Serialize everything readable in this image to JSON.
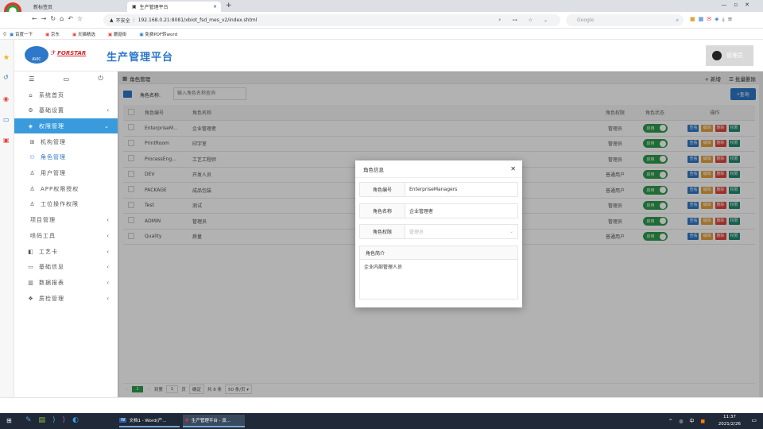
{
  "browser": {
    "tabs": [
      {
        "label": "新标签页"
      },
      {
        "label": "生产管理平台"
      }
    ],
    "security_label": "不安全",
    "url": "192.168.0.21:8081/xbiot_fsd_mes_v2/index.shtml",
    "search_engine": "Google",
    "bookmarks": [
      "百度一下",
      "京东",
      "天猫精选",
      "蘑菇街",
      "免费PDF转word"
    ]
  },
  "app": {
    "brand": "FORSTAR",
    "logo_sub": "AVIC",
    "title": "生产管理平台",
    "user_name": "管理员"
  },
  "sidebar": {
    "items": [
      {
        "label": "系统首页",
        "icon": "home-icon",
        "type": "top"
      },
      {
        "label": "基础设置",
        "icon": "gear-icon",
        "type": "top",
        "chev": "‹"
      },
      {
        "label": "权限管理",
        "icon": "shield-icon",
        "type": "active",
        "chev": "⌄"
      },
      {
        "label": "机构管理",
        "icon": "org-icon",
        "type": "sub"
      },
      {
        "label": "角色管理",
        "icon": "users-icon",
        "type": "subact"
      },
      {
        "label": "用户管理",
        "icon": "user-icon",
        "type": "sub"
      },
      {
        "label": "APP权限授权",
        "icon": "user-icon",
        "type": "sub"
      },
      {
        "label": "工位操作权限",
        "icon": "user-icon",
        "type": "sub"
      },
      {
        "label": "项目管理",
        "icon": "",
        "type": "top",
        "chev": "‹"
      },
      {
        "label": "喷码工具",
        "icon": "",
        "type": "top",
        "chev": "‹"
      },
      {
        "label": "工艺卡",
        "icon": "card-icon",
        "type": "top",
        "chev": "‹"
      },
      {
        "label": "基础信息",
        "icon": "monitor-icon",
        "type": "top",
        "chev": "‹"
      },
      {
        "label": "数据报表",
        "icon": "report-icon",
        "type": "top",
        "chev": "‹"
      },
      {
        "label": "质检管理",
        "icon": "layers-icon",
        "type": "top",
        "chev": "‹"
      }
    ]
  },
  "panel": {
    "title": "角色管理",
    "add_label": "新增",
    "batch_delete_label": "批量删除",
    "filter_label": "角色名称:",
    "filter_placeholder": "输入角色名称查询",
    "query_label": "查询"
  },
  "table": {
    "headers": {
      "code": "角色编号",
      "name": "角色名称",
      "perm": "角色权限",
      "status": "角色状态",
      "ops": "操作"
    },
    "rows": [
      {
        "code": "EnterpriseM...",
        "name": "企业管理者",
        "perm": "管理员",
        "status": "启用"
      },
      {
        "code": "PrintRoom",
        "name": "印字室",
        "perm": "管理员",
        "status": "启用"
      },
      {
        "code": "ProcessEng...",
        "name": "工艺工程师",
        "perm": "管理员",
        "status": "启用"
      },
      {
        "code": "DEV",
        "name": "开发人员",
        "perm": "普通用户",
        "status": "启用"
      },
      {
        "code": "PACKAGE",
        "name": "成品包装",
        "perm": "普通用户",
        "status": "启用"
      },
      {
        "code": "Test",
        "name": "测试",
        "perm": "管理员",
        "status": "启用"
      },
      {
        "code": "ADMIN",
        "name": "管理员",
        "perm": "管理员",
        "status": "启用"
      },
      {
        "code": "Quality",
        "name": "质量",
        "perm": "普通用户",
        "status": "启用"
      }
    ],
    "op_labels": {
      "view": "查看",
      "edit": "编辑",
      "del": "删除",
      "perm": "权限"
    }
  },
  "pagination": {
    "current_page": "1",
    "goto_label": "到第",
    "goto_value": "1",
    "page_unit": "页",
    "confirm_label": "确定",
    "total_label": "共 8 条",
    "page_size": "50 条/页"
  },
  "modal": {
    "title": "角色信息",
    "fields": [
      {
        "label": "角色编号",
        "value": "EnterpriseManagers"
      },
      {
        "label": "角色名称",
        "value": "企业管理者"
      },
      {
        "label": "角色权限",
        "value": "管理员"
      }
    ],
    "desc_label": "角色简介",
    "desc_value": "企业内部管理人员"
  },
  "taskbar": {
    "items": [
      "文档1 - Word(产...",
      "生产管理平台 - 双..."
    ],
    "tray_text": "中",
    "time": "11:37",
    "date": "2021/2/26"
  },
  "colors": {
    "accent": "#3a9bdc",
    "primary": "#2d78c8",
    "success": "#2e9b4c"
  }
}
